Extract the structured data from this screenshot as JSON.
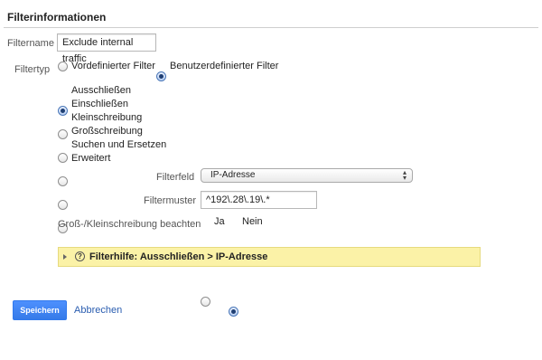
{
  "section_title": "Filterinformationen",
  "filtername": {
    "label": "Filtername",
    "value": "Exclude internal traffic"
  },
  "filtertyp": {
    "label": "Filtertyp",
    "options": [
      {
        "label": "Vordefinierter Filter",
        "selected": false
      },
      {
        "label": "Benutzerdefinierter Filter",
        "selected": true
      }
    ]
  },
  "filter_actions": [
    {
      "label": "Ausschließen",
      "selected": true
    },
    {
      "label": "Einschließen",
      "selected": false
    },
    {
      "label": "Kleinschreibung",
      "selected": false
    },
    {
      "label": "Großschreibung",
      "selected": false
    },
    {
      "label": "Suchen und Ersetzen",
      "selected": false
    },
    {
      "label": "Erweitert",
      "selected": false
    }
  ],
  "filterfeld": {
    "label": "Filterfeld",
    "selected_value": "IP-Adresse"
  },
  "filtermuster": {
    "label": "Filtermuster",
    "value": "^192\\.28\\.19\\.*"
  },
  "case_sensitive": {
    "label": "Groß-/Kleinschreibung beachten",
    "options": [
      {
        "label": "Ja",
        "selected": false
      },
      {
        "label": "Nein",
        "selected": true
      }
    ]
  },
  "filter_help": {
    "text": "Filterhilfe: Ausschließen  >  IP-Adresse"
  },
  "buttons": {
    "save": "Speichern",
    "cancel": "Abbrechen"
  },
  "colors": {
    "hint_background": "#fbf2a7",
    "primary_button": "#4d90fe",
    "link": "#2a5db0"
  }
}
